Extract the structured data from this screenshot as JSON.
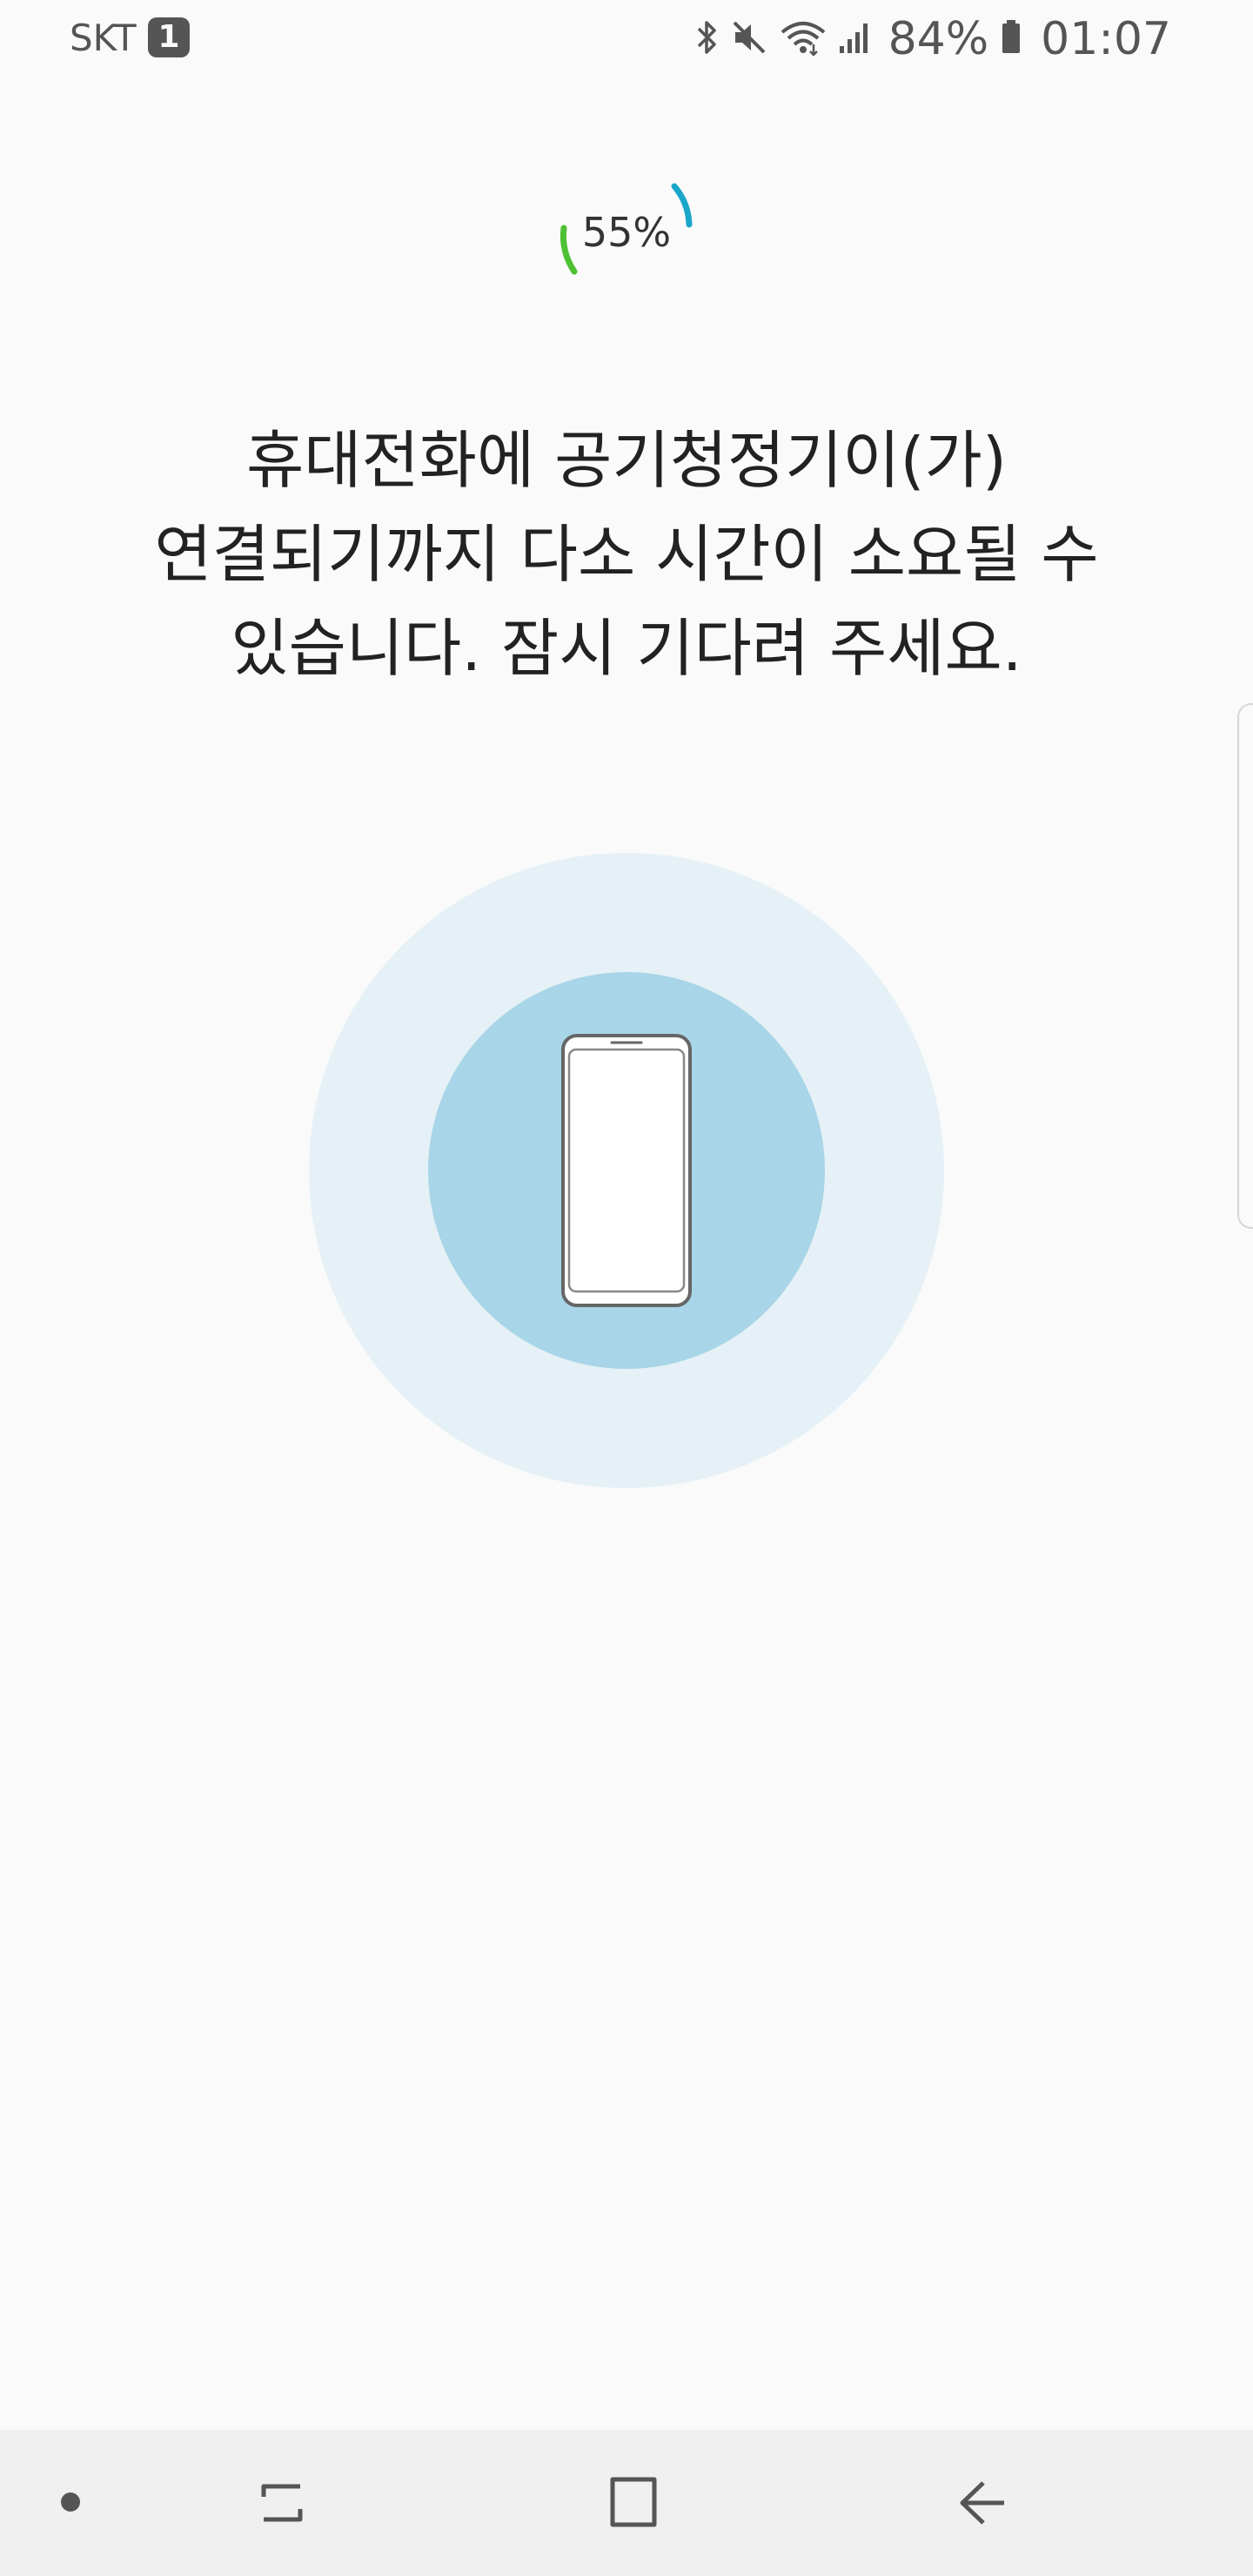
{
  "status_bar": {
    "carrier": "SKT",
    "sim_slot": "1",
    "battery_percent": "84%",
    "time": "01:07",
    "icons": [
      "bluetooth-icon",
      "mute-icon",
      "wifi-icon",
      "signal-icon",
      "battery-icon"
    ]
  },
  "progress": {
    "label": "55%",
    "value": 55,
    "colors": [
      "#4ec133",
      "#1aa6c9"
    ]
  },
  "message": {
    "text": "휴대전화에 공기청정기이(가)\n연결되기까지 다소 시간이 소요될 수\n있습니다. 잠시 기다려 주세요."
  },
  "illustration": {
    "icon": "phone-icon",
    "outer_color": "#e5f1f6",
    "inner_color": "#a8d5e7"
  },
  "nav_bar": {
    "buttons": [
      "dot-indicator",
      "recent-apps-icon",
      "home-icon",
      "back-icon"
    ]
  }
}
